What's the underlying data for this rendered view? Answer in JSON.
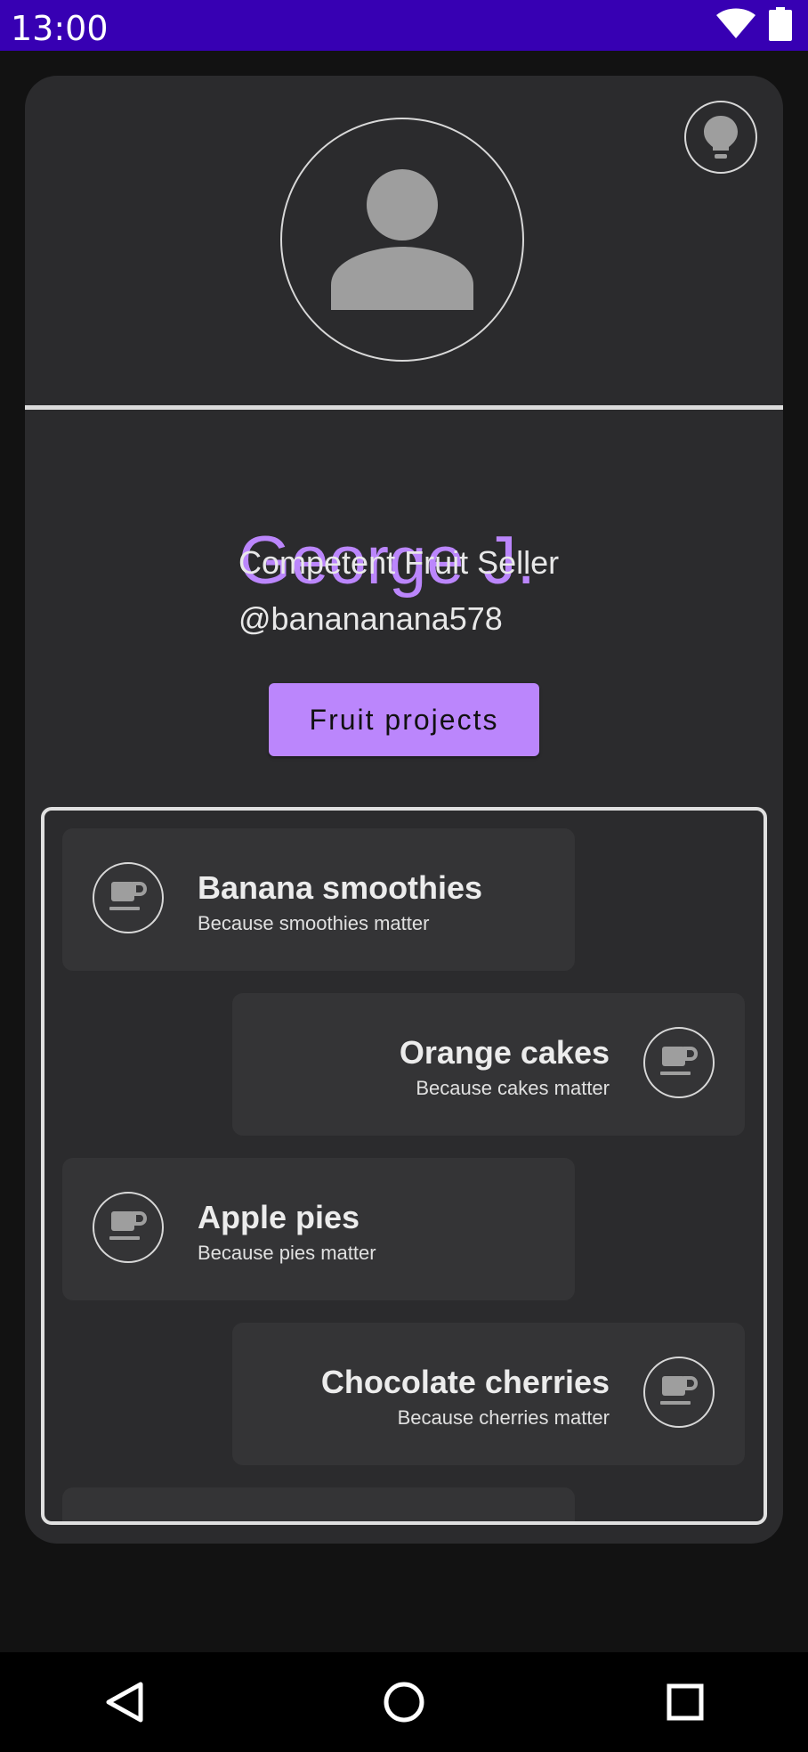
{
  "status_bar": {
    "time": "13:00",
    "icons": [
      "wifi-icon",
      "battery-icon"
    ]
  },
  "profile": {
    "name": "George J.",
    "title": "Competent Fruit Seller",
    "handle": "@banananana578",
    "projects_button": "Fruit projects"
  },
  "projects": [
    {
      "title": "Banana smoothies",
      "subtitle": "Because smoothies matter",
      "icon": "coffee-cup-icon"
    },
    {
      "title": "Orange cakes",
      "subtitle": "Because cakes matter",
      "icon": "coffee-cup-icon"
    },
    {
      "title": "Apple pies",
      "subtitle": "Because pies matter",
      "icon": "coffee-cup-icon"
    },
    {
      "title": "Chocolate cherries",
      "subtitle": "Because cherries matter",
      "icon": "coffee-cup-icon"
    }
  ],
  "nav": [
    "back-icon",
    "home-icon",
    "recents-icon"
  ],
  "colors": {
    "status_bar": "#3700B3",
    "accent": "#BB86FC",
    "card": "#2B2B2D",
    "background": "#121212"
  }
}
